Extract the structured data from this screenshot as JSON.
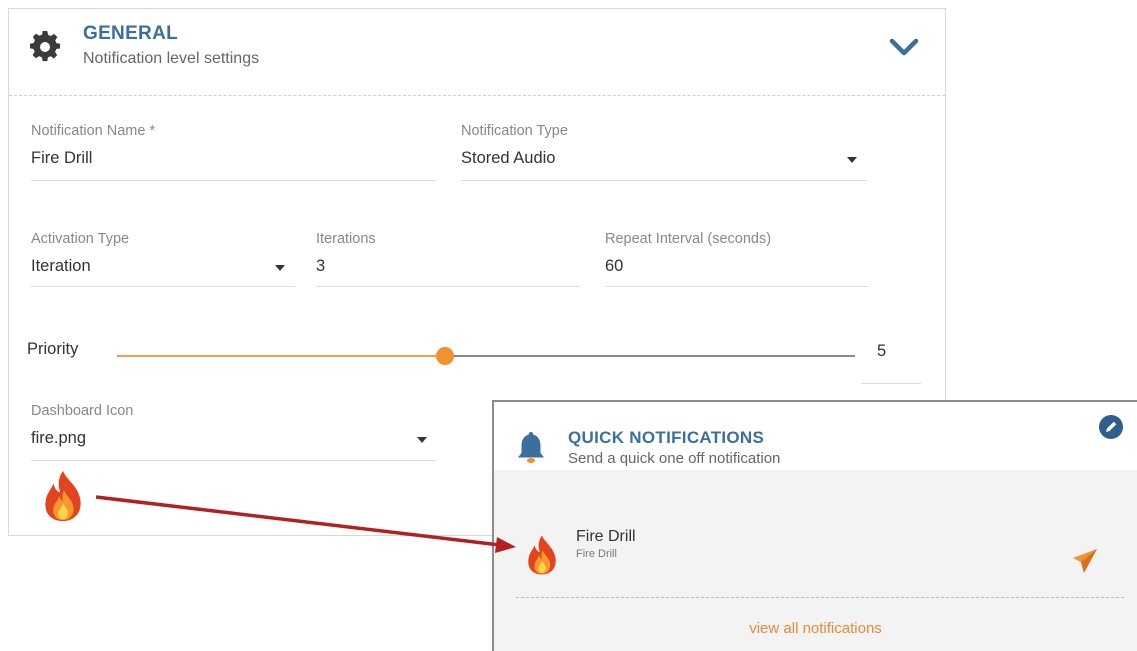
{
  "general": {
    "title": "GENERAL",
    "subtitle": "Notification level settings",
    "icon": "gear-icon",
    "toggle_icon": "chevron-down-icon",
    "fields": {
      "notification_name": {
        "label": "Notification Name *",
        "value": "Fire Drill"
      },
      "notification_type": {
        "label": "Notification Type",
        "value": "Stored Audio"
      },
      "activation_type": {
        "label": "Activation Type",
        "value": "Iteration"
      },
      "iterations": {
        "label": "Iterations",
        "value": "3"
      },
      "repeat_interval": {
        "label": "Repeat Interval (seconds)",
        "value": "60"
      },
      "dashboard_icon": {
        "label": "Dashboard Icon",
        "value": "fire.png"
      }
    },
    "priority": {
      "label": "Priority",
      "value": "5",
      "level_fraction": 0.445
    }
  },
  "quick_notifications": {
    "title": "QUICK NOTIFICATIONS",
    "subtitle": "Send a quick one off notification",
    "icon": "bell-icon",
    "edit_icon": "edit-pencil-icon",
    "items": [
      {
        "name": "Fire Drill",
        "description": "Fire Drill",
        "icon": "fire-icon",
        "action_icon": "send-icon"
      }
    ],
    "view_all_label": "view all notifications"
  },
  "colors": {
    "accent_blue": "#3a6f9f",
    "accent_orange": "#f0922e",
    "arrow_red": "#b3201f"
  }
}
